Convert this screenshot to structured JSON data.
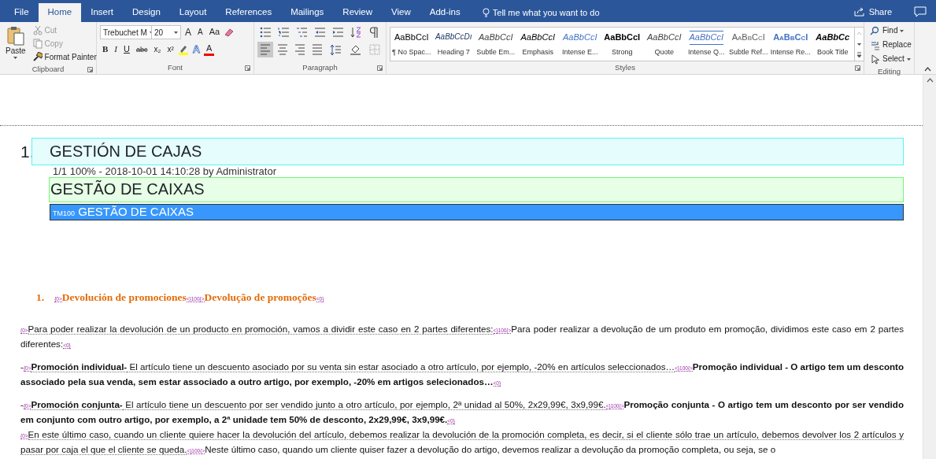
{
  "tabs": [
    {
      "label": "File",
      "selected": false
    },
    {
      "label": "Home",
      "selected": true
    },
    {
      "label": "Insert",
      "selected": false
    },
    {
      "label": "Design",
      "selected": false
    },
    {
      "label": "Layout",
      "selected": false
    },
    {
      "label": "References",
      "selected": false
    },
    {
      "label": "Mailings",
      "selected": false
    },
    {
      "label": "Review",
      "selected": false
    },
    {
      "label": "View",
      "selected": false
    },
    {
      "label": "Add-ins",
      "selected": false
    }
  ],
  "tell_me": "Tell me what you want to do",
  "share": "Share",
  "ribbon": {
    "clipboard": {
      "label": "Clipboard",
      "paste": "Paste",
      "items": [
        {
          "label": "Cut",
          "disabled": true
        },
        {
          "label": "Copy",
          "disabled": true
        },
        {
          "label": "Format Painter",
          "disabled": false
        }
      ]
    },
    "font": {
      "label": "Font",
      "name": "Trebuchet M",
      "size": "20",
      "row1": [
        {
          "label": "A",
          "kind": "grow"
        },
        {
          "label": "A",
          "kind": "shrink"
        },
        {
          "label": "Aa",
          "kind": "case"
        }
      ],
      "row2": [
        {
          "label": "B",
          "kind": "bold"
        },
        {
          "label": "I",
          "kind": "italic"
        },
        {
          "label": "U",
          "kind": "underline"
        },
        {
          "label": "abc",
          "kind": "strike"
        },
        {
          "label": "x₂",
          "kind": "sub"
        },
        {
          "label": "x²",
          "kind": "super"
        },
        {
          "label": "A",
          "kind": "effects"
        },
        {
          "label": "A",
          "kind": "color"
        }
      ]
    },
    "paragraph": {
      "label": "Paragraph",
      "alignments": [
        {
          "selected": true
        },
        {
          "selected": false
        },
        {
          "selected": false
        },
        {
          "selected": false
        }
      ]
    },
    "styles": {
      "label": "Styles",
      "items": [
        {
          "preview": "AaBbCcI",
          "name": "¶ No Spac...",
          "kind": "plain"
        },
        {
          "preview": "AaBbCcDı",
          "name": "Heading 7",
          "kind": "heading"
        },
        {
          "preview": "AaBbCcI",
          "name": "Subtle Em...",
          "kind": "subtle"
        },
        {
          "preview": "AaBbCcI",
          "name": "Emphasis",
          "kind": "emphasis"
        },
        {
          "preview": "AaBbCcI",
          "name": "Intense E...",
          "kind": "intense"
        },
        {
          "preview": "AaBbCcI",
          "name": "Strong",
          "kind": "strong"
        },
        {
          "preview": "AaBbCcI",
          "name": "Quote",
          "kind": "quote"
        },
        {
          "preview": "AaBbCcI",
          "name": "Intense Q...",
          "kind": "intensequote"
        },
        {
          "preview": "AaBbCcI",
          "name": "Subtle Ref...",
          "kind": "subtleref"
        },
        {
          "preview": "AaBbCcI",
          "name": "Intense Re...",
          "kind": "intenseref"
        },
        {
          "preview": "AaBbCc",
          "name": "Book Title",
          "kind": "booktitle"
        }
      ]
    },
    "editing": {
      "label": "Editing",
      "items": [
        {
          "label": "Find",
          "kind": "find"
        },
        {
          "label": "Replace",
          "kind": "replace"
        },
        {
          "label": "Select",
          "kind": "select"
        }
      ]
    }
  },
  "document": {
    "title_number": "1.",
    "title": "GESTIÓN DE CAJAS",
    "meta": "1/1 100% - 2018-10-01 14:10:28 by Administrator",
    "translation": "GESTÃO DE CAIXAS",
    "segment_tag": "TM100",
    "segment_text": "GESTÃO DE CAIXAS",
    "section": {
      "number": "1.",
      "segments": [
        {
          "kind": "tag",
          "text": "{0>"
        },
        {
          "kind": "heading",
          "text": "Devolución de promociones"
        },
        {
          "kind": "tag",
          "text": "<}100{>"
        },
        {
          "kind": "heading",
          "text": "Devolução de promoções"
        },
        {
          "kind": "tag",
          "text": "<0}"
        }
      ]
    },
    "paragraphs": [
      {
        "segments": [
          {
            "kind": "tag",
            "text": "{0>"
          },
          {
            "kind": "source",
            "text": "Para poder realizar la devolución de un producto en promoción, vamos a dividir este caso en 2 partes diferentes:"
          },
          {
            "kind": "tag",
            "text": "<}100{>"
          },
          {
            "kind": "target",
            "text": "Para poder realizar a devolução de um produto em promoção, dividimos este caso em 2 partes diferentes:"
          },
          {
            "kind": "tag",
            "text": "<0}"
          }
        ]
      },
      {
        "segments": [
          {
            "kind": "target",
            "text": "-"
          },
          {
            "kind": "tag",
            "text": "{0>"
          },
          {
            "kind": "source-bold",
            "text": "Promoción individual-"
          },
          {
            "kind": "source",
            "text": " El artículo tiene un descuento asociado por su venta sin estar asociado a otro artículo, por ejemplo, -20% en artículos seleccionados…"
          },
          {
            "kind": "tag",
            "text": "<}100{>"
          },
          {
            "kind": "target-bold",
            "text": "Promoção individual - O artigo tem um desconto associado pela sua venda, sem estar associado a outro artigo, por exemplo, -20% em artigos selecionados…"
          },
          {
            "kind": "tag",
            "text": "<0}"
          }
        ]
      },
      {
        "segments": [
          {
            "kind": "target",
            "text": "-"
          },
          {
            "kind": "tag",
            "text": "{0>"
          },
          {
            "kind": "source-bold",
            "text": "Promoción conjunta-"
          },
          {
            "kind": "source",
            "text": " El artículo tiene un descuento por ser vendido junto a otro artículo, por ejemplo, 2ª unidad al 50%, 2x29,99€, 3x9,99€."
          },
          {
            "kind": "tag",
            "text": "<}100{>"
          },
          {
            "kind": "target-bold",
            "text": "Promoção conjunta - O artigo tem um desconto por ser vendido em conjunto com outro artigo, por exemplo, a 2ª unidade tem 50% de desconto, 2x29,99€, 3x9,99€."
          },
          {
            "kind": "tag",
            "text": "<0}"
          }
        ]
      },
      {
        "segments": [
          {
            "kind": "tag",
            "text": "{0>"
          },
          {
            "kind": "source",
            "text": "En este último caso, cuando un cliente quiere hacer la devolución del artículo, debemos realizar la devolución de la promoción completa, es decir, si el cliente sólo trae un artículo, debemos devolver los 2 artículos y pasar por caja el que el cliente se queda."
          },
          {
            "kind": "tag",
            "text": "<}100{>"
          },
          {
            "kind": "target",
            "text": "Neste último caso, quando um cliente quiser fazer a devolução do artigo, devemos realizar a devolução da promoção completa, ou seja, se o"
          }
        ]
      }
    ]
  }
}
